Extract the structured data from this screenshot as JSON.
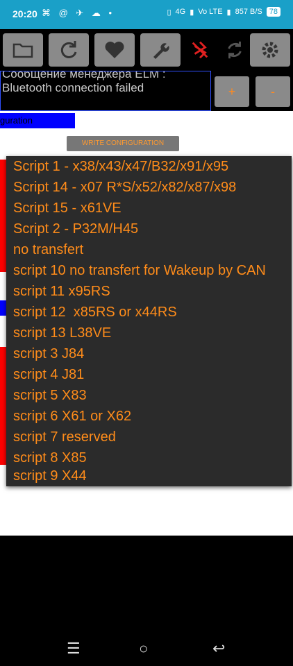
{
  "status": {
    "time": "20:20",
    "left_icons": "⌘ @ ✈ ☁ •",
    "network": "4G",
    "carrier": "Vo LTE",
    "speed": "857 B/S",
    "battery": "78"
  },
  "toolbar": {
    "buttons": [
      "folder-icon",
      "refresh-icon",
      "heart-icon",
      "wrench-icon",
      "bluetooth-off-icon",
      "sync-icon",
      "settings-icon"
    ]
  },
  "message": {
    "line1": "Сообщение менеджера ELM :",
    "line2": "Bluetooth connection failed"
  },
  "plus_label": "+",
  "minus_label": "-",
  "config_label": "guration",
  "write_label": "WRITE CONFIGURATION",
  "dropdown": {
    "items": [
      "Script 1 - x38/x43/x47/B32/x91/x95",
      "Script 14 - x07 R*S/x52/x82/x87/x98",
      "Script 15 - x61VE",
      "Script 2 - P32M/H45",
      "no transfert",
      "script 10 no transfert for Wakeup by CAN",
      "script 11 x95RS",
      "script 12  x85RS or x44RS",
      "script 13 L38VE",
      "script 3 J84",
      "script 4 J81",
      "script 5 X83",
      "script 6 X61 or X62",
      "script 7 reserved",
      "script 8 X85",
      "script 9 X44"
    ]
  },
  "colors": {
    "accent": "#ff8c1a",
    "statusbar": "#1aa0c8",
    "button": "#8a8a8a",
    "dropdown_bg": "#2b2b2b"
  }
}
